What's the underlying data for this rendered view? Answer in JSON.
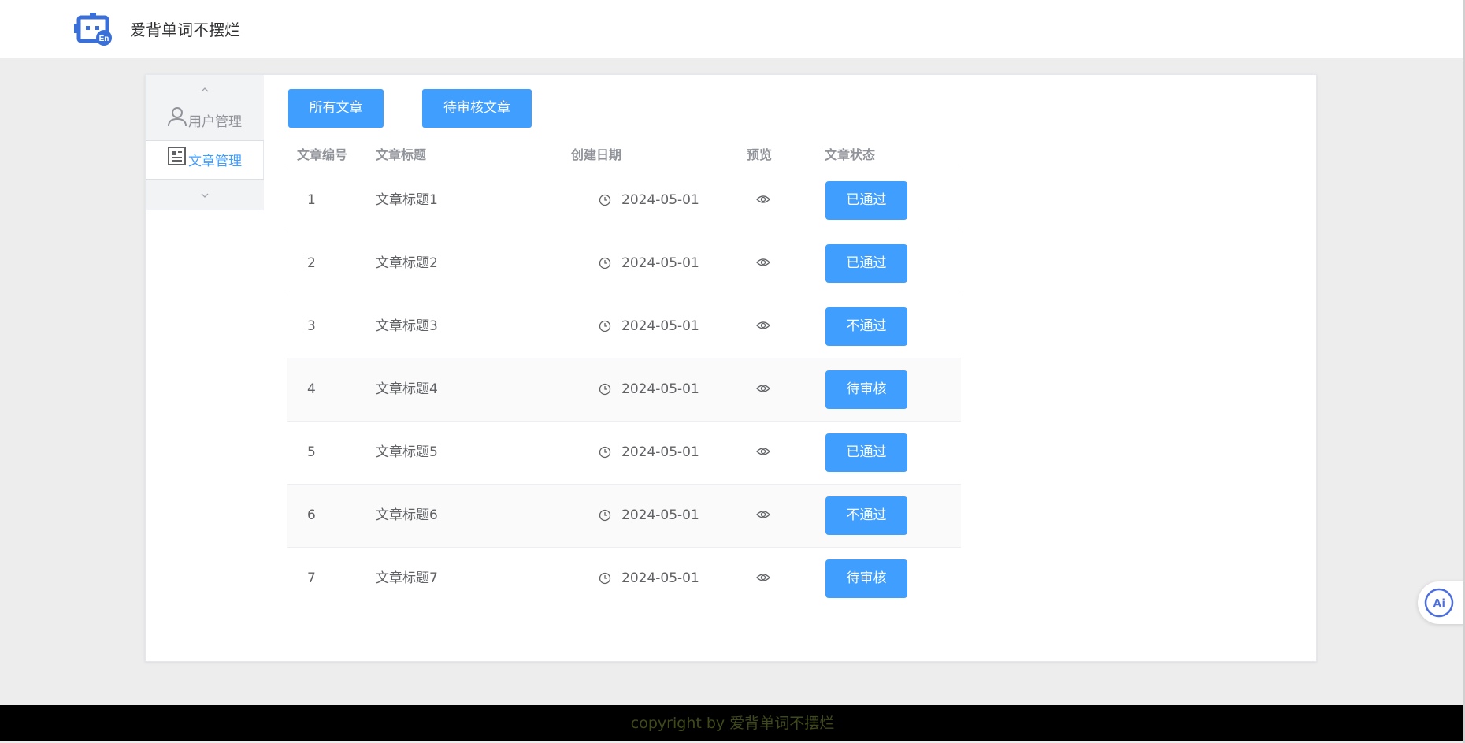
{
  "app": {
    "title": "爱背单词不摆烂"
  },
  "sidebar": {
    "items": [
      {
        "label": "用户管理",
        "icon": "user-icon",
        "active": false
      },
      {
        "label": "文章管理",
        "icon": "document-icon",
        "active": true
      }
    ]
  },
  "tabs": [
    {
      "label": "所有文章"
    },
    {
      "label": "待审核文章"
    }
  ],
  "table": {
    "headers": {
      "id": "文章编号",
      "title": "文章标题",
      "date": "创建日期",
      "preview": "预览",
      "status": "文章状态"
    },
    "rows": [
      {
        "id": "1",
        "title": "文章标题1",
        "date": "2024-05-01",
        "status": "已通过"
      },
      {
        "id": "2",
        "title": "文章标题2",
        "date": "2024-05-01",
        "status": "已通过"
      },
      {
        "id": "3",
        "title": "文章标题3",
        "date": "2024-05-01",
        "status": "不通过"
      },
      {
        "id": "4",
        "title": "文章标题4",
        "date": "2024-05-01",
        "status": "待审核"
      },
      {
        "id": "5",
        "title": "文章标题5",
        "date": "2024-05-01",
        "status": "已通过"
      },
      {
        "id": "6",
        "title": "文章标题6",
        "date": "2024-05-01",
        "status": "不通过"
      },
      {
        "id": "7",
        "title": "文章标题7",
        "date": "2024-05-01",
        "status": "待审核"
      }
    ]
  },
  "footer": {
    "text": "copyright by 爱背单词不摆烂"
  },
  "colors": {
    "primary": "#409eff",
    "footer_bg": "#000000",
    "page_bg": "#ededed"
  }
}
